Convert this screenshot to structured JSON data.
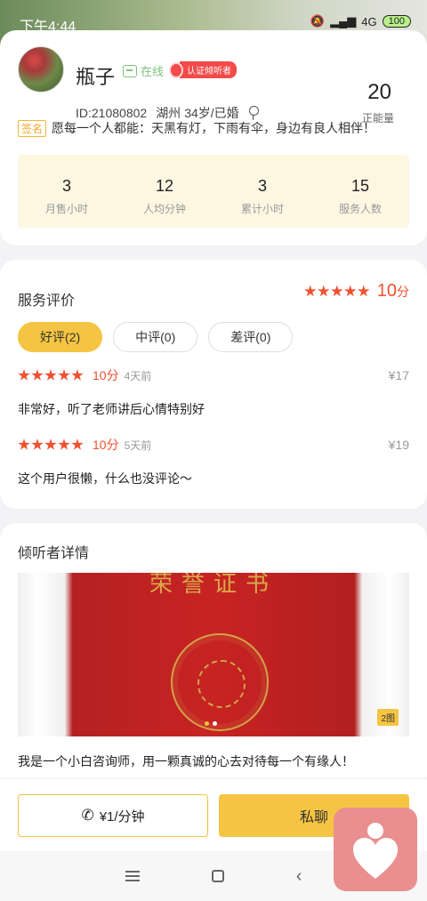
{
  "status_bar": {
    "time": "下午4:44",
    "network": "4G",
    "battery": "100"
  },
  "profile": {
    "name": "瓶子",
    "online_label": "在线",
    "cert_label": "认证倾听者",
    "energy_value": "20",
    "energy_label": "正能量",
    "id": "ID:21080802",
    "location": "湖州",
    "age_status": "34岁/已婚",
    "sign_tag": "签名",
    "signature": "愿每一个人都能：天黑有灯，下雨有伞，身边有良人相伴！"
  },
  "stats": [
    {
      "value": "3",
      "label": "月售小时"
    },
    {
      "value": "12",
      "label": "人均分钟"
    },
    {
      "value": "3",
      "label": "累计小时"
    },
    {
      "value": "15",
      "label": "服务人数"
    }
  ],
  "reviews_section": {
    "title": "服务评价",
    "overall_score": "10",
    "overall_unit": "分",
    "overall_stars": 5,
    "tabs": [
      {
        "label": "好评(2)",
        "active": true
      },
      {
        "label": "中评(0)",
        "active": false
      },
      {
        "label": "差评(0)",
        "active": false
      }
    ],
    "items": [
      {
        "stars": 5,
        "score": "10分",
        "time": "4天前",
        "price": "¥17",
        "text": "非常好，听了老师讲后心情特别好"
      },
      {
        "stars": 5,
        "score": "10分",
        "time": "5天前",
        "price": "¥19",
        "text": "这个用户很懒，什么也没评论～"
      }
    ]
  },
  "details_section": {
    "title": "倾听者详情",
    "photo_title": "荣誉证书",
    "photo_count": "2图",
    "photo_index": 2,
    "intro": "我是一个小白咨询师，用一颗真诚的心去对待每一个有缘人！"
  },
  "actions": {
    "call_label": "¥1/分钟",
    "chat_label": "私聊"
  },
  "colors": {
    "accent": "#f5c442",
    "score_red": "#f0502e",
    "online_green": "#7ec27e"
  }
}
